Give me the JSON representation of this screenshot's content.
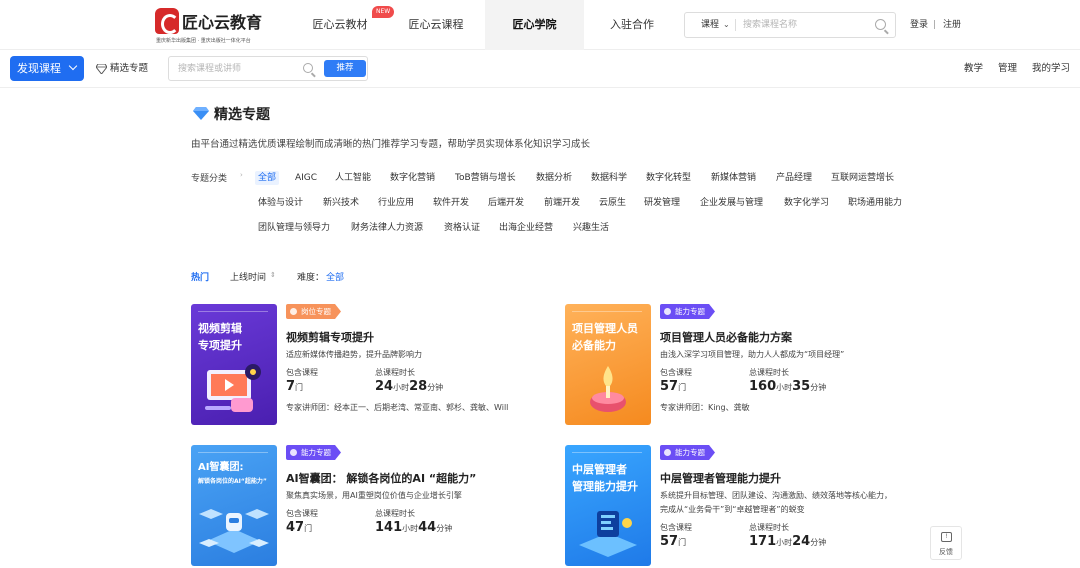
{
  "header": {
    "brand": "匠心云教育",
    "brand_sub": "重庆新华出版集团 · 重庆出版社一体化平台",
    "nav": [
      {
        "label": "匠心云教材"
      },
      {
        "label": "匠心云课程"
      },
      {
        "label": "匠心学院",
        "active": true
      },
      {
        "label": "入驻合作"
      }
    ],
    "new_badge": "NEW",
    "search": {
      "category": "课程",
      "placeholder": "搜索课程名称"
    },
    "login": "登录",
    "separator": "|",
    "register": "注册"
  },
  "subbar": {
    "discover_label": "发现课程",
    "featured_label": "精选专题",
    "search_placeholder": "搜索课程或讲师",
    "recommend_label": "推荐",
    "right_links": [
      "教学",
      "管理",
      "我的学习"
    ]
  },
  "main": {
    "title": "精选专题",
    "intro": "由平台通过精选优质课程绘制而成清晰的热门推荐学习专题，帮助学员实现体系化知识学习成长",
    "category_label": "专题分类",
    "categories_row1": [
      "全部",
      "AIGC",
      "人工智能",
      "数字化营销",
      "ToB营销与增长",
      "数据分析",
      "数据科学",
      "数字化转型",
      "新媒体营销",
      "产品经理",
      "互联网运营增长"
    ],
    "categories_row2": [
      "体验与设计",
      "新兴技术",
      "行业应用",
      "软件开发",
      "后端开发",
      "前端开发",
      "云原生",
      "研发管理",
      "企业发展与管理",
      "数字化学习",
      "职场通用能力"
    ],
    "categories_row3": [
      "团队管理与领导力",
      "财务法律人力资源",
      "资格认证",
      "出海企业经营",
      "兴趣生活"
    ],
    "sort": {
      "hot": "热门",
      "online_time": "上线时间",
      "sort_icon": "⇕",
      "difficulty_label": "难度：",
      "difficulty_value": "全部"
    }
  },
  "cards": [
    {
      "thumb_lines": [
        "视频剪辑",
        "专项提升"
      ],
      "thumb_color": "#5b2bc7",
      "tag": "岗位专题",
      "tag_color": "orange",
      "title": "视频剪辑专项提升",
      "desc": [
        "适应新媒体传播趋势，提升品牌影响力"
      ],
      "courses_label": "包含课程",
      "courses": "7",
      "courses_unit": "门",
      "duration_label": "总课程时长",
      "hours": "24",
      "hours_unit": "小时",
      "minutes": "28",
      "minutes_unit": "分钟",
      "experts": "专家讲师团：经本正一、后期老湾、常亚南、郭杉、龚敏、Will"
    },
    {
      "thumb_lines": [
        "项目管理人员",
        "必备能力"
      ],
      "thumb_color": "#f5972e",
      "tag": "能力专题",
      "tag_color": "purple",
      "title": "项目管理人员必备能力方案",
      "desc": [
        "由浅入深学习项目管理，助力人人都成为“项目经理”"
      ],
      "courses_label": "包含课程",
      "courses": "57",
      "courses_unit": "门",
      "duration_label": "总课程时长",
      "hours": "160",
      "hours_unit": "小时",
      "minutes": "35",
      "minutes_unit": "分钟",
      "experts": "专家讲师团：King、龚敏"
    },
    {
      "thumb_lines": [
        "AI智囊团:",
        "解锁各岗位的AI“超能力”"
      ],
      "thumb_color": "#3a8fe8",
      "tag": "能力专题",
      "tag_color": "purple",
      "title": "AI智囊团： 解锁各岗位的AI “超能力”",
      "desc": [
        "聚焦真实场景，用AI重塑岗位价值与企业增长引擎"
      ],
      "courses_label": "包含课程",
      "courses": "47",
      "courses_unit": "门",
      "duration_label": "总课程时长",
      "hours": "141",
      "hours_unit": "小时",
      "minutes": "44",
      "minutes_unit": "分钟",
      "experts": ""
    },
    {
      "thumb_lines": [
        "中层管理者",
        "管理能力提升"
      ],
      "thumb_color": "#2f8bf0",
      "tag": "能力专题",
      "tag_color": "purple",
      "title": "中层管理者管理能力提升",
      "desc": [
        "系统提升目标管理、团队建设、沟通激励、绩效落地等核心能力，",
        "完成从“业务骨干”到“卓越管理者”的蜕变"
      ],
      "courses_label": "包含课程",
      "courses": "57",
      "courses_unit": "门",
      "duration_label": "总课程时长",
      "hours": "171",
      "hours_unit": "小时",
      "minutes": "24",
      "minutes_unit": "分钟",
      "experts": ""
    }
  ],
  "feedback": {
    "label": "反馈",
    "icon": "!"
  },
  "colors": {
    "accent": "#1f6df1",
    "tag_orange": "#f7935b",
    "tag_purple": "#6b4ef5"
  }
}
